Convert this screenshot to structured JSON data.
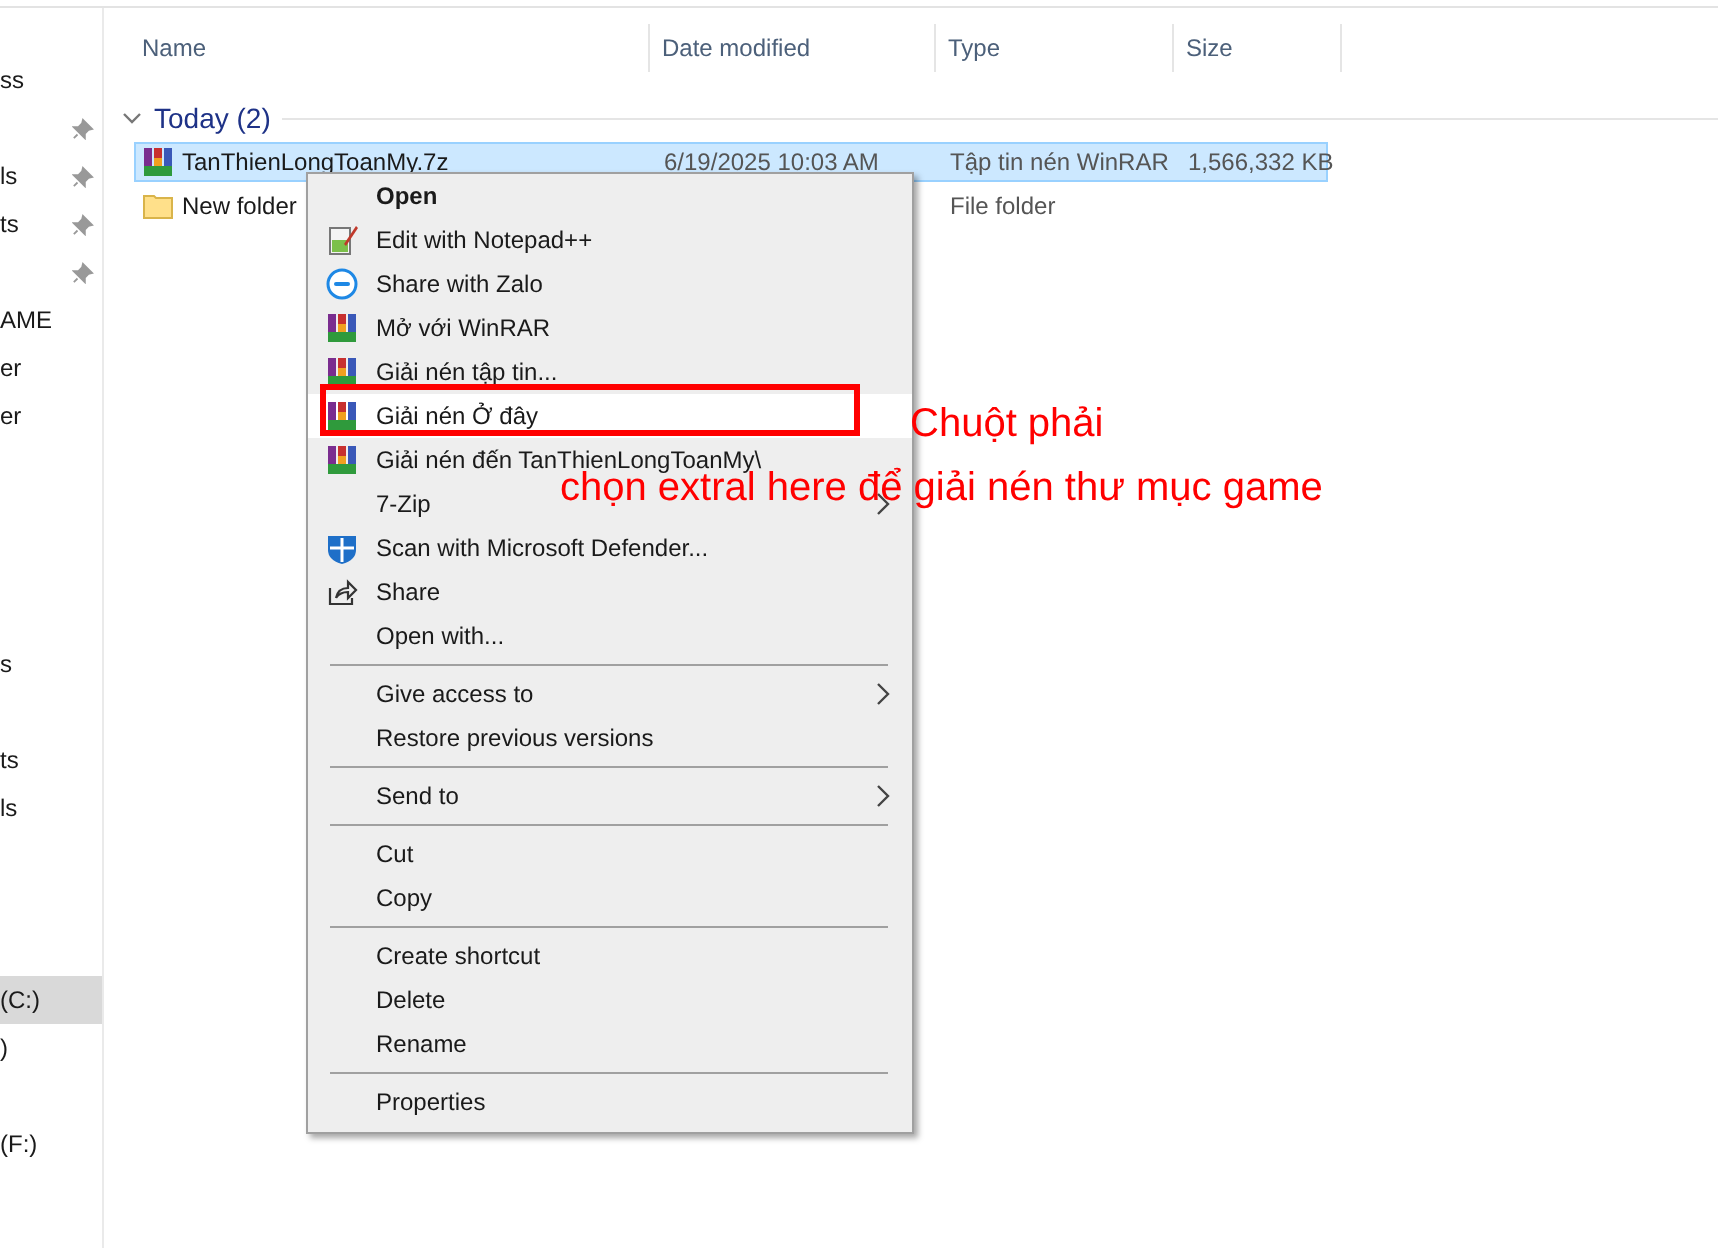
{
  "sidebar": {
    "groups": [
      [
        {
          "text": "ss",
          "pinned": false,
          "selected": false
        },
        {
          "pinned": true,
          "selected": false
        },
        {
          "text": "ls",
          "pinned": true,
          "selected": false
        },
        {
          "text": "ts",
          "pinned": true,
          "selected": false
        },
        {
          "pinned": true,
          "selected": false
        },
        {
          "text": "AME",
          "pinned": false,
          "selected": false
        },
        {
          "text": "er",
          "pinned": false,
          "selected": false
        },
        {
          "text": "er",
          "pinned": false,
          "selected": false
        }
      ],
      [
        {
          "text": "s",
          "pinned": false,
          "selected": false
        }
      ],
      [
        {
          "text": "ts",
          "pinned": false,
          "selected": false
        },
        {
          "text": "ls",
          "pinned": false,
          "selected": false
        }
      ],
      [
        {
          "text": "(C:)",
          "pinned": false,
          "selected": true
        },
        {
          "text": ")",
          "pinned": false,
          "selected": false
        }
      ],
      [
        {
          "text": "(F:)",
          "pinned": false,
          "selected": false
        }
      ]
    ]
  },
  "table": {
    "columns": [
      "Name",
      "Date modified",
      "Type",
      "Size"
    ],
    "group": {
      "label": "Today (2)",
      "expanded": true
    },
    "rows": [
      {
        "kind": "archive",
        "name": "TanThienLongToanMy.7z",
        "date": "6/19/2025 10:03 AM",
        "type": "Tập tin nén WinRAR",
        "size": "1,566,332 KB",
        "selected": true
      },
      {
        "kind": "folder",
        "name": "New folder",
        "type": "File folder",
        "selected": false
      }
    ]
  },
  "context_menu": {
    "sections": [
      [
        {
          "label": "Open",
          "kind": "plain",
          "default": true,
          "submenu": false,
          "selected": false
        },
        {
          "label": "Edit with Notepad++",
          "kind": "notepad",
          "default": false,
          "submenu": false,
          "selected": false
        },
        {
          "label": "Share with Zalo",
          "kind": "zalo",
          "default": false,
          "submenu": false,
          "selected": false
        },
        {
          "label": "Mở với WinRAR",
          "kind": "archive",
          "default": false,
          "submenu": false,
          "selected": false
        },
        {
          "label": "Giải nén tập tin...",
          "kind": "archive",
          "default": false,
          "submenu": false,
          "selected": false
        },
        {
          "label": "Giải nén Ở đây",
          "kind": "archive",
          "default": false,
          "submenu": false,
          "selected": true
        },
        {
          "label": "Giải nén đến TanThienLongToanMy\\",
          "kind": "archive",
          "default": false,
          "submenu": false,
          "selected": false
        },
        {
          "label": "7-Zip",
          "kind": "plain",
          "default": false,
          "submenu": true,
          "selected": false
        },
        {
          "label": "Scan with Microsoft Defender...",
          "kind": "shield",
          "default": false,
          "submenu": false,
          "selected": false
        },
        {
          "label": "Share",
          "kind": "share",
          "default": false,
          "submenu": false,
          "selected": false
        },
        {
          "label": "Open with...",
          "kind": "plain",
          "default": false,
          "submenu": false,
          "selected": false
        }
      ],
      [
        {
          "label": "Give access to",
          "kind": "plain",
          "default": false,
          "submenu": true,
          "selected": false
        },
        {
          "label": "Restore previous versions",
          "kind": "plain",
          "default": false,
          "submenu": false,
          "selected": false
        }
      ],
      [
        {
          "label": "Send to",
          "kind": "plain",
          "default": false,
          "submenu": true,
          "selected": false
        }
      ],
      [
        {
          "label": "Cut",
          "kind": "plain",
          "default": false,
          "submenu": false,
          "selected": false
        },
        {
          "label": "Copy",
          "kind": "plain",
          "default": false,
          "submenu": false,
          "selected": false
        }
      ],
      [
        {
          "label": "Create shortcut",
          "kind": "plain",
          "default": false,
          "submenu": false,
          "selected": false
        },
        {
          "label": "Delete",
          "kind": "plain",
          "default": false,
          "submenu": false,
          "selected": false
        },
        {
          "label": "Rename",
          "kind": "plain",
          "default": false,
          "submenu": false,
          "selected": false
        }
      ],
      [
        {
          "label": "Properties",
          "kind": "plain",
          "default": false,
          "submenu": false,
          "selected": false
        }
      ]
    ]
  },
  "annotation": {
    "lines": [
      "Chuột phải",
      "chọn extral here để giải nén thư mục game"
    ]
  }
}
